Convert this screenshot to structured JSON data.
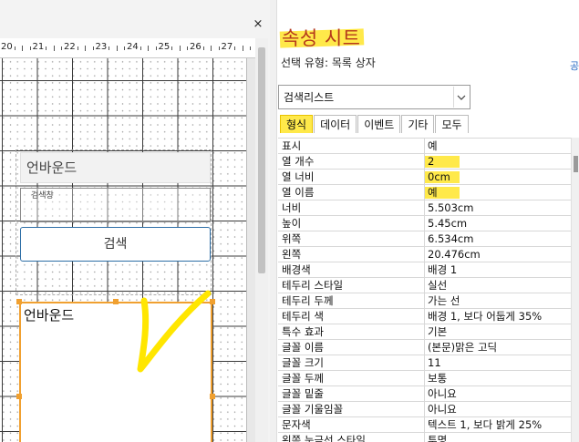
{
  "design": {
    "close_glyph": "×",
    "ruler": [
      "20",
      "21",
      "22",
      "23",
      "24",
      "25",
      "26",
      "27"
    ],
    "label_unbound_1": "언바운드",
    "search_field_label": "검색창",
    "search_button": "검색",
    "listbox_label": "언바운드"
  },
  "sheet": {
    "title": "속성 시트",
    "selection_type": "선택 유형:  목록 상자",
    "corner_glyph": "공",
    "object_name": "검색리스트",
    "tabs": [
      {
        "label": "형식",
        "active": true
      },
      {
        "label": "데이터",
        "active": false
      },
      {
        "label": "이벤트",
        "active": false
      },
      {
        "label": "기타",
        "active": false
      },
      {
        "label": "모두",
        "active": false
      }
    ],
    "rows": [
      {
        "k": "표시",
        "v": "예"
      },
      {
        "k": "열 개수",
        "v": "2"
      },
      {
        "k": "열 너비",
        "v": "0cm"
      },
      {
        "k": "열 이름",
        "v": "예"
      },
      {
        "k": "너비",
        "v": "5.503cm"
      },
      {
        "k": "높이",
        "v": "5.45cm"
      },
      {
        "k": "위쪽",
        "v": "6.534cm"
      },
      {
        "k": "왼쪽",
        "v": "20.476cm"
      },
      {
        "k": "배경색",
        "v": "배경 1"
      },
      {
        "k": "테두리 스타일",
        "v": "실선"
      },
      {
        "k": "테두리 두께",
        "v": "가는 선"
      },
      {
        "k": "테두리 색",
        "v": "배경 1, 보다 어둡게 35%"
      },
      {
        "k": "특수 효과",
        "v": "기본"
      },
      {
        "k": "글꼴 이름",
        "v": "(본문)맑은 고딕"
      },
      {
        "k": "글꼴 크기",
        "v": "11"
      },
      {
        "k": "글꼴 두께",
        "v": "보통"
      },
      {
        "k": "글꼴 밑줄",
        "v": "아니요"
      },
      {
        "k": "글꼴 기울임꼴",
        "v": "아니요"
      },
      {
        "k": "문자색",
        "v": "텍스트 1, 보다 밝게 25%"
      },
      {
        "k": "왼쪽 눈금선 스타일",
        "v": "투명"
      }
    ],
    "highlighted_rows": [
      "열 개수",
      "열 너비",
      "열 이름"
    ]
  },
  "colors": {
    "highlight": "#ffe94a",
    "title": "#b5391c",
    "selection": "#f0a030",
    "button_border": "#2d6ea6"
  }
}
